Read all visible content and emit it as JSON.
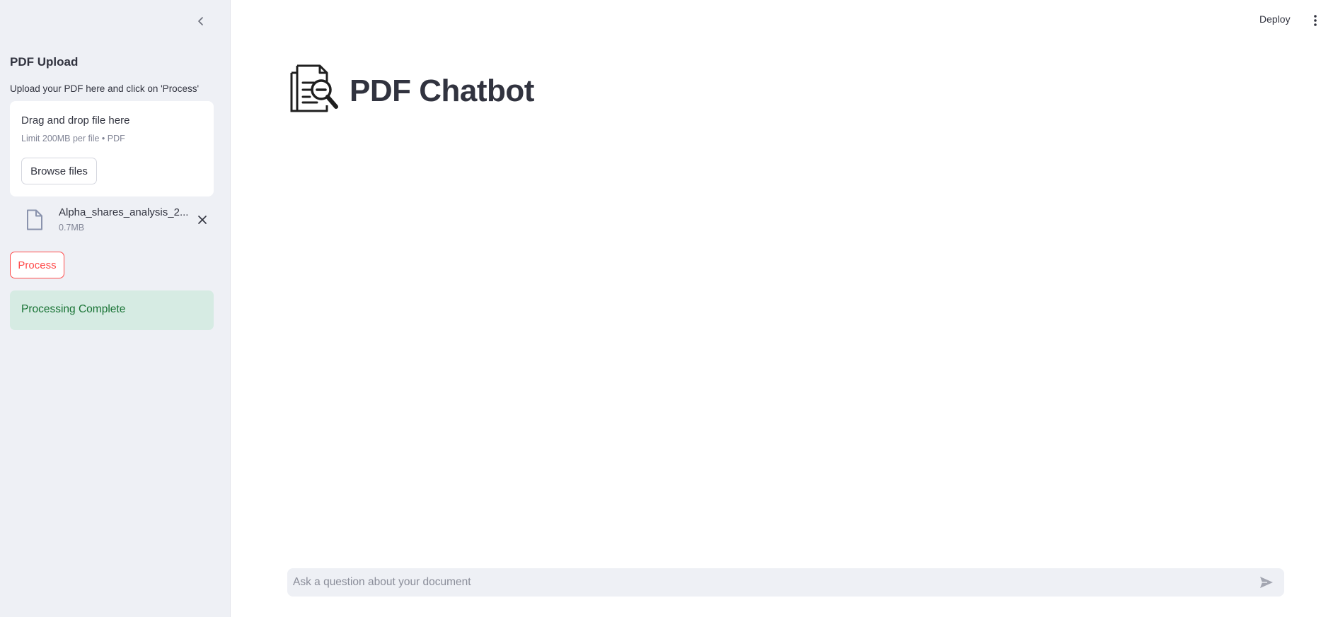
{
  "sidebar": {
    "collapse_icon": "chevron-left-icon",
    "title": "PDF Upload",
    "description": "Upload your PDF here and click on 'Process'",
    "dropzone": {
      "title": "Drag and drop file here",
      "limit": "Limit 200MB per file • PDF",
      "browse_label": "Browse files"
    },
    "file": {
      "icon": "file-icon",
      "name": "Alpha_shares_analysis_2...",
      "size": "0.7MB",
      "remove_icon": "close-icon"
    },
    "process_label": "Process",
    "status": "Processing Complete"
  },
  "header": {
    "deploy_label": "Deploy",
    "menu_icon": "kebab-menu-icon"
  },
  "main": {
    "logo_icon": "document-search-icon",
    "title": "PDF Chatbot"
  },
  "chat": {
    "placeholder": "Ask a question about your document",
    "send_icon": "send-icon"
  },
  "colors": {
    "accent": "#ff4b4b",
    "sidebar_bg": "#eef0f5",
    "success_bg": "#d6ebe3",
    "success_text": "#177233",
    "text": "#31333f"
  }
}
